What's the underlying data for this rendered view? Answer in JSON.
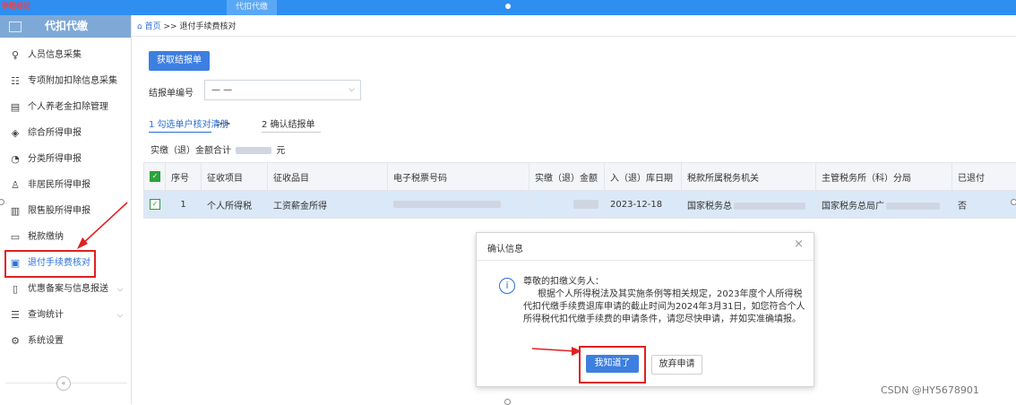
{
  "topbar": {
    "brand": "学税标记",
    "module_tab": "代扣代缴"
  },
  "sidebar": {
    "title": "代扣代缴",
    "collapse_glyph": "«",
    "items": [
      {
        "label": "人员信息采集",
        "icon": "person-icon",
        "glyph": "♀"
      },
      {
        "label": "专项附加扣除信息采集",
        "icon": "list-icon",
        "glyph": "☷"
      },
      {
        "label": "个人养老金扣除管理",
        "icon": "document-icon",
        "glyph": "▤"
      },
      {
        "label": "综合所得申报",
        "icon": "layers-icon",
        "glyph": "◈"
      },
      {
        "label": "分类所得申报",
        "icon": "clock-icon",
        "glyph": "◔"
      },
      {
        "label": "非居民所得申报",
        "icon": "user-icon",
        "glyph": "♙"
      },
      {
        "label": "限售股所得申报",
        "icon": "bar-chart-icon",
        "glyph": "▥"
      },
      {
        "label": "税款缴纳",
        "icon": "folder-icon",
        "glyph": "▭"
      },
      {
        "label": "退付手续费核对",
        "icon": "refund-icon",
        "glyph": "▣",
        "active": true
      },
      {
        "label": "优惠备案与信息报送",
        "icon": "file-icon",
        "glyph": "▯",
        "has_submenu": true
      },
      {
        "label": "查询统计",
        "icon": "query-icon",
        "glyph": "☰",
        "has_submenu": true
      },
      {
        "label": "系统设置",
        "icon": "gear-icon",
        "glyph": "⚙"
      }
    ]
  },
  "breadcrumb": {
    "home": "首页",
    "separator": ">>",
    "current": "退付手续费核对"
  },
  "fetch_button": "获取结报单",
  "form": {
    "bill_no_label": "结报单编号",
    "bill_no_value": "— —"
  },
  "steps": {
    "step1": "1 勾选单户核对清册",
    "separator": ">>",
    "step2": "2 确认结报单"
  },
  "summary": {
    "label": "实缴（退）金额合计",
    "unit": "元"
  },
  "table": {
    "columns": [
      "序号",
      "征收项目",
      "征收品目",
      "电子税票号码",
      "实缴（退）金额",
      "入（退）库日期",
      "税款所属税务机关",
      "主管税务所（科）分局",
      "已退付"
    ],
    "rows": [
      {
        "no": "1",
        "item": "个人所得税",
        "category": "工资薪金所得",
        "date": "2023-12-18",
        "tax_office": "国家税务总",
        "branch": "国家税务总局广",
        "refunded": "否"
      }
    ]
  },
  "dialog": {
    "title": "确认信息",
    "greeting": "尊敬的扣缴义务人：",
    "body": "根据个人所得税法及其实施条例等相关规定，2023年度个人所得税代扣代缴手续费退库申请的截止时间为2024年3月31日，如您符合个人所得税代扣代缴手续费的申请条件，请您尽快申请，并如实准确填报。",
    "ok_button": "我知道了",
    "abandon_button": "放弃申请"
  },
  "watermark": "CSDN @HY5678901",
  "colors": {
    "primary": "#3d7fe0",
    "annotation": "#e02020",
    "selected_row": "#dbe8f7",
    "topbar": "#2f8ff0"
  }
}
